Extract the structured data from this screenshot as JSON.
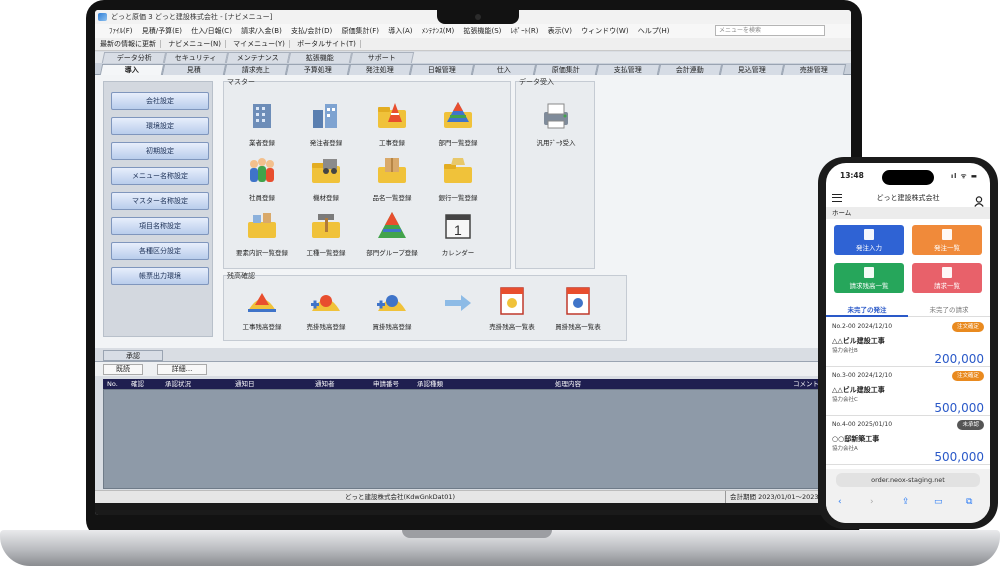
{
  "window_title": "どっと原価 3  どっと建設株式会社 - [ナビメニュー]",
  "menubar": [
    "ﾌｧｲﾙ(F)",
    "見積/予算(E)",
    "仕入/日報(C)",
    "請求/入金(B)",
    "支払/会計(D)",
    "原価集計(F)",
    "導入(A)",
    "ﾒﾝﾃﾅﾝｽ(M)",
    "拡張機能(S)",
    "ﾚﾎﾟｰﾄ(R)",
    "表示(V)",
    "ウィンドウ(W)",
    "ヘルプ(H)"
  ],
  "menu_search_placeholder": "メニューを検索",
  "toolbar": [
    "最新の情報に更新",
    "ナビメニュー(N)",
    "マイメニュー(Y)",
    "ポータルサイト(T)"
  ],
  "top_tabs": [
    "データ分析",
    "セキュリティ",
    "メンテナンス",
    "拡張機能",
    "サポート"
  ],
  "main_tabs": [
    "導入",
    "見積",
    "請求売上",
    "予算処理",
    "発注処理",
    "日報管理",
    "仕入",
    "原価集計",
    "支払管理",
    "会計連動",
    "見込管理",
    "売掛管理"
  ],
  "left_buttons": [
    "会社設定",
    "環境設定",
    "初期設定",
    "メニュー名称設定",
    "マスター名称設定",
    "項目名称設定",
    "各種区分設定",
    "帳票出力環境"
  ],
  "master_label": "マスター",
  "master_items": [
    "業者登録",
    "発注者登録",
    "工事登録",
    "部門一覧登録",
    "社員登録",
    "機材登録",
    "品名一覧登録",
    "銀行一覧登録",
    "要素内訳一覧登録",
    "工種一覧登録",
    "部門グループ登録",
    "カレンダー"
  ],
  "data_receive_label": "データ受入",
  "data_receive_item": "汎用ﾃﾞｰﾀ受入",
  "balance_label": "残高確認",
  "balance_items": [
    "工事残高登録",
    "売掛残高登録",
    "買掛残高登録",
    "売掛残高一覧表",
    "買掛残高一覧表"
  ],
  "approval": {
    "tab": "承認",
    "buttons": [
      "既読",
      "詳細..."
    ],
    "columns": [
      "No.",
      "確認",
      "承認状況",
      "通知日",
      "通知者",
      "申請番号",
      "承認種類",
      "処理内容",
      "コメント"
    ]
  },
  "statusbar": {
    "company": "どっと建設株式会社(KdwGnkDat01)",
    "period": "会計期間 2023/01/01～2023/"
  },
  "phone": {
    "time": "13:48",
    "status": "ıl ᯤ ▬",
    "header": "どっと建設株式会社",
    "breadcrumb": "ホーム",
    "tiles": [
      {
        "label": "発注入力",
        "color": "#2f63d4"
      },
      {
        "label": "発注一覧",
        "color": "#f08a3a"
      },
      {
        "label": "請求残高一覧",
        "color": "#26a65b"
      },
      {
        "label": "請求一覧",
        "color": "#e8616a"
      }
    ],
    "tabs": [
      "未完了の発注",
      "未完了の請求"
    ],
    "cards": [
      {
        "no": "No.2-00  2024/12/10",
        "badge": "注文確定",
        "badge_color": "#e98a1f",
        "name": "△△ビル建設工事",
        "sub": "協力会社B",
        "amount": "200,000"
      },
      {
        "no": "No.3-00  2024/12/10",
        "badge": "注文確定",
        "badge_color": "#e98a1f",
        "name": "△△ビル建設工事",
        "sub": "協力会社C",
        "amount": "500,000"
      },
      {
        "no": "No.4-00  2025/01/10",
        "badge": "未承認",
        "badge_color": "#555555",
        "name": "○○邸新築工事",
        "sub": "協力会社A",
        "amount": "500,000"
      }
    ],
    "url": "order.neox-staging.net"
  }
}
